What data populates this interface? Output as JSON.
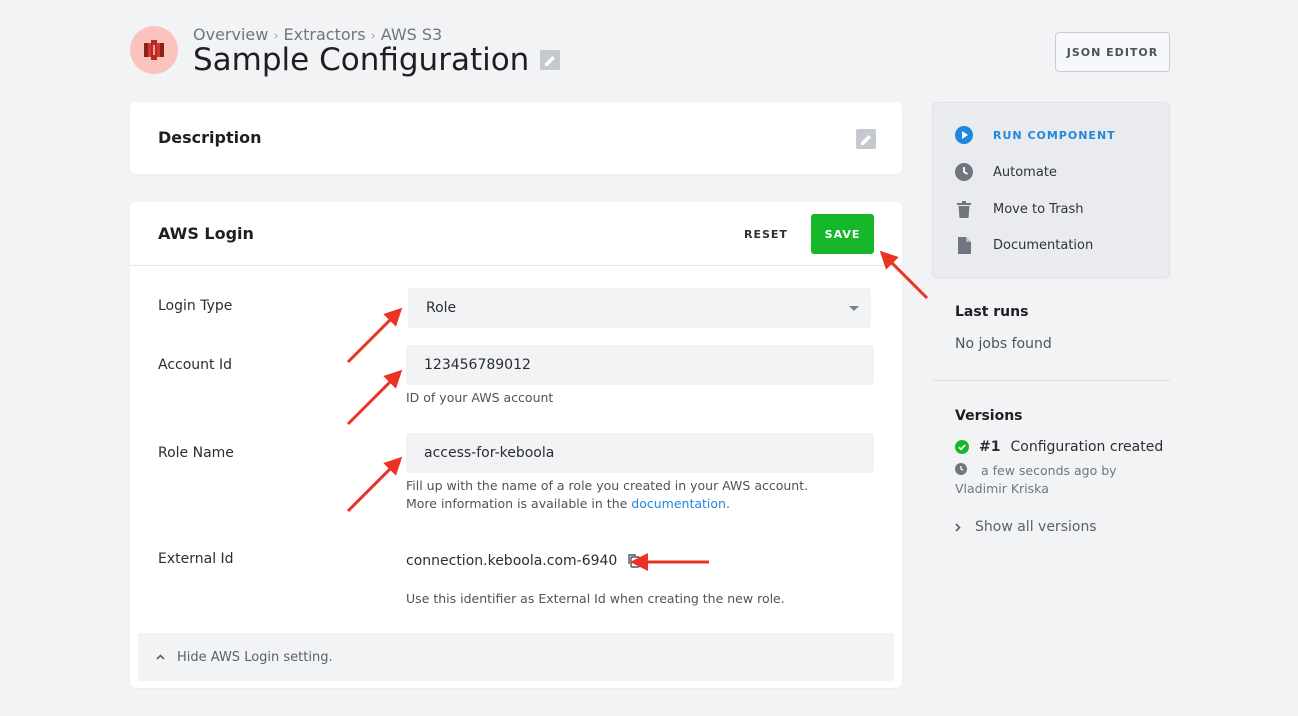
{
  "breadcrumb": [
    "Overview",
    "Extractors",
    "AWS S3"
  ],
  "page_title": "Sample Configuration",
  "json_editor_label": "JSON EDITOR",
  "description": {
    "title": "Description"
  },
  "aws_login": {
    "title": "AWS Login",
    "reset_label": "RESET",
    "save_label": "SAVE",
    "login_type": {
      "label": "Login Type",
      "value": "Role"
    },
    "account_id": {
      "label": "Account Id",
      "value": "123456789012",
      "help": "ID of your AWS account"
    },
    "role_name": {
      "label": "Role Name",
      "value": "access-for-keboola",
      "help_prefix": "Fill up with the name of a role you created in your AWS account. More information is available in the ",
      "help_link": "documentation",
      "help_suffix": "."
    },
    "external_id": {
      "label": "External Id",
      "value": "connection.keboola.com-6940",
      "help": "Use this identifier as External Id when creating the new role."
    },
    "hide_label": "Hide AWS Login setting."
  },
  "sidebar": {
    "actions": [
      {
        "label": "RUN COMPONENT",
        "icon": "play-circle-icon"
      },
      {
        "label": "Automate",
        "icon": "clock-icon"
      },
      {
        "label": "Move to Trash",
        "icon": "trash-icon"
      },
      {
        "label": "Documentation",
        "icon": "file-icon"
      }
    ],
    "last_runs": {
      "title": "Last runs",
      "empty": "No jobs found"
    },
    "versions": {
      "title": "Versions",
      "entry_number": "#1",
      "entry_text": "Configuration created",
      "entry_meta": "a few seconds ago by Vladimir Kriska",
      "show_all": "Show all versions"
    }
  },
  "colors": {
    "accent": "#1f87e0",
    "save": "#16b82a",
    "annotation": "#ea3323",
    "logo_bg": "#fbc3bd"
  }
}
